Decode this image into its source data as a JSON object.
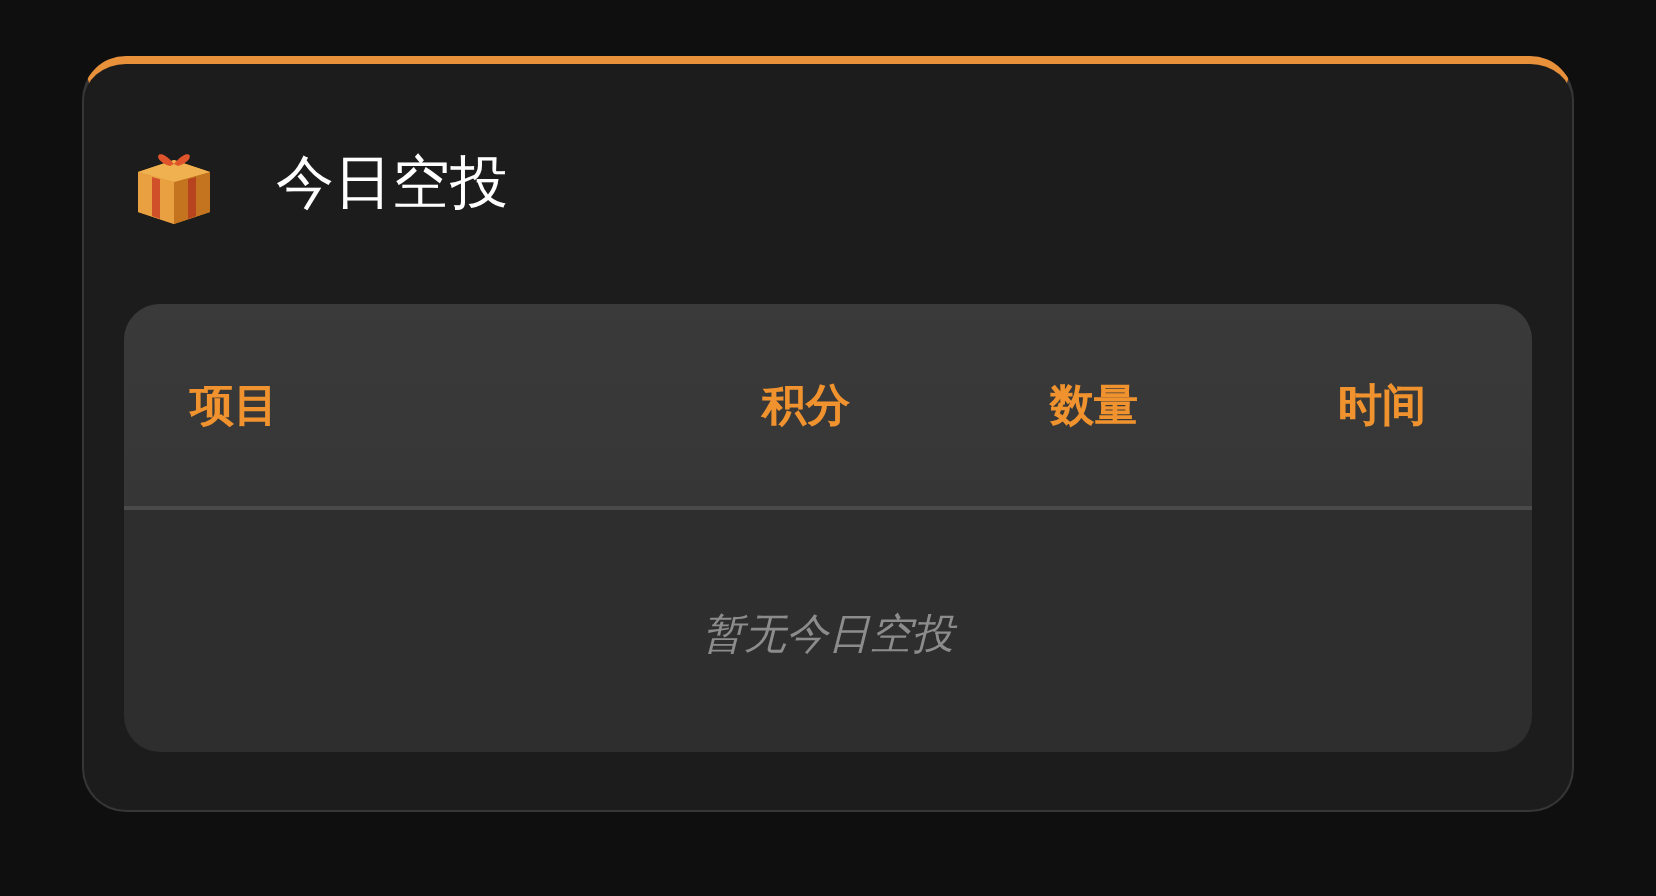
{
  "card": {
    "title": "今日空投"
  },
  "table": {
    "columns": [
      "项目",
      "积分",
      "数量",
      "时间"
    ],
    "empty_message": "暂无今日空投"
  }
}
